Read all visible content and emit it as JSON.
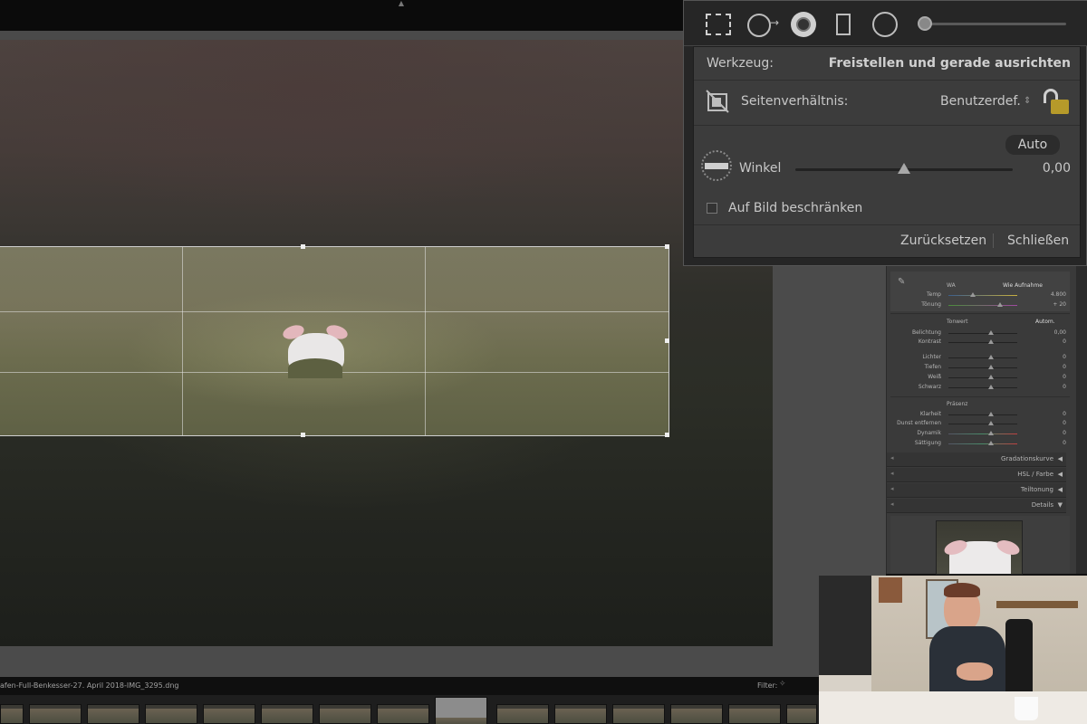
{
  "popup": {
    "werkzeug_label": "Werkzeug:",
    "werkzeug_value": "Freistellen und gerade ausrichten",
    "seitenverhaeltnis_label": "Seitenverhältnis:",
    "seitenverhaeltnis_value": "Benutzerdef.",
    "seitenverhaeltnis_arrow": "⇕",
    "auto_label": "Auto",
    "winkel_label": "Winkel",
    "winkel_value": "0,00",
    "winkel_fraction": 0.5,
    "beschraenken_label": "Auf Bild beschränken",
    "reset_label": "Zurücksetzen",
    "close_label": "Schließen"
  },
  "panel": {
    "wb_label": "WA",
    "wb_value": "Wie Aufnahme",
    "sliders_basic": [
      {
        "label": "Temp",
        "value": "4.800"
      },
      {
        "label": "Tönung",
        "value": "+ 20"
      }
    ],
    "tonwert_label": "Tonwert",
    "tonwert_auto": "Autom.",
    "sliders_tone": [
      {
        "label": "Belichtung",
        "value": "0,00"
      },
      {
        "label": "Kontrast",
        "value": "0"
      },
      {
        "label": "Lichter",
        "value": "0"
      },
      {
        "label": "Tiefen",
        "value": "0"
      },
      {
        "label": "Weiß",
        "value": "0"
      },
      {
        "label": "Schwarz",
        "value": "0"
      }
    ],
    "praesenz_label": "Präsenz",
    "sliders_presence": [
      {
        "label": "Klarheit",
        "value": "0"
      },
      {
        "label": "Dunst entfernen",
        "value": "0"
      },
      {
        "label": "Dynamik",
        "value": "0"
      },
      {
        "label": "Sättigung",
        "value": "0"
      }
    ],
    "sections": [
      {
        "label": "Gradationskurve",
        "arrow": "◀"
      },
      {
        "label": "HSL / Farbe",
        "arrow": "◀"
      },
      {
        "label": "Teiltonung",
        "arrow": "◀"
      },
      {
        "label": "Details",
        "arrow": "▼"
      }
    ]
  },
  "filmstrip": {
    "path": "afen-Full-Benkesser-27. April 2018-IMG_3295.dng",
    "filter_label": "Filter:"
  },
  "colors": {
    "accent_lock": "#b69a2a",
    "panel_bg": "#3c3c3c",
    "popup_bg": "#262626"
  },
  "icons": [
    "crop-overlay-icon",
    "spot-removal-icon",
    "red-eye-icon",
    "graduated-filter-icon",
    "radial-filter-icon",
    "adjustment-brush-slider",
    "aspect-ratio-icon",
    "lock-icon",
    "straighten-level-icon",
    "eyedropper-icon"
  ]
}
